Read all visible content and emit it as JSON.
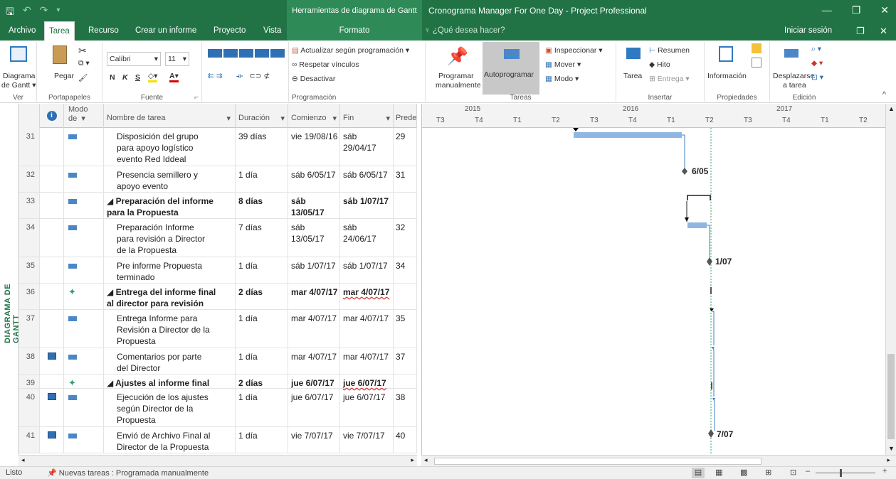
{
  "titlebar": {
    "context_title": "Herramientas de diagrama de Gantt",
    "title": "Cronograma Manager For One Day - Project Professional"
  },
  "tabs": {
    "archivo": "Archivo",
    "tarea": "Tarea",
    "recurso": "Recurso",
    "informe": "Crear un informe",
    "proyecto": "Proyecto",
    "vista": "Vista",
    "formato": "Formato",
    "tell_me": "¿Qué desea hacer?",
    "signin": "Iniciar sesión"
  },
  "ribbon": {
    "ver": {
      "label": "Ver",
      "diagrama": "Diagrama",
      "de_gantt": "de Gantt"
    },
    "portapapeles": {
      "label": "Portapapeles",
      "pegar": "Pegar"
    },
    "fuente": {
      "label": "Fuente",
      "font": "Calibri",
      "size": "11"
    },
    "programacion": {
      "label": "Programación",
      "actualizar": "Actualizar según programación",
      "respetar": "Respetar vínculos",
      "desactivar": "Desactivar"
    },
    "tareas": {
      "label": "Tareas",
      "programar": "Programar",
      "manualmente": "manualmente",
      "autoprogramar": "Autoprogramar",
      "inspeccionar": "Inspeccionar",
      "mover": "Mover",
      "modo": "Modo"
    },
    "insertar": {
      "label": "Insertar",
      "tarea": "Tarea",
      "resumen": "Resumen",
      "hito": "Hito",
      "entrega": "Entrega"
    },
    "propiedades": {
      "label": "Propiedades",
      "informacion": "Información"
    },
    "edicion": {
      "label": "Edición",
      "desplazarse": "Desplazarse",
      "a_tarea": "a tarea"
    }
  },
  "side_label": "DIAGRAMA DE GANTT",
  "table": {
    "headers": {
      "modo1": "Modo",
      "modo2": "de",
      "name": "Nombre de tarea",
      "duration": "Duración",
      "start": "Comienzo",
      "finish": "Fin",
      "pred": "Prede"
    },
    "rows": [
      {
        "id": "31",
        "name1": "Disposición del grupo",
        "name2": "para apoyo logístico",
        "name3": "evento Red Iddeal",
        "dur": "39 días",
        "start1": "vie 19/08/16",
        "start2": "",
        "fin1": "sáb",
        "fin2": "29/04/17",
        "pred": "29"
      },
      {
        "id": "32",
        "name1": "Presencia semillero y",
        "name2": "apoyo evento",
        "name3": "",
        "dur": "1 día",
        "start1": "sáb 6/05/17",
        "start2": "",
        "fin1": "sáb 6/05/17",
        "fin2": "",
        "pred": "31"
      },
      {
        "id": "33",
        "name1": "◢ Preparación del informe",
        "name2": "para la Propuesta",
        "name3": "",
        "dur": "8 días",
        "start1": "sáb",
        "start2": "13/05/17",
        "fin1": "sáb 1/07/17",
        "fin2": "",
        "pred": ""
      },
      {
        "id": "34",
        "name1": "Preparación Informe",
        "name2": "para revisión a Director",
        "name3": "de la Propuesta",
        "dur": "7 días",
        "start1": "sáb",
        "start2": "13/05/17",
        "fin1": "sáb",
        "fin2": "24/06/17",
        "pred": "32"
      },
      {
        "id": "35",
        "name1": "Pre informe Propuesta",
        "name2": "terminado",
        "name3": "",
        "dur": "1 día",
        "start1": "sáb 1/07/17",
        "start2": "",
        "fin1": "sáb 1/07/17",
        "fin2": "",
        "pred": "34"
      },
      {
        "id": "36",
        "name1": "◢ Entrega del informe final",
        "name2": "al director para revisión",
        "name3": "",
        "dur": "2 días",
        "start1": "mar 4/07/17",
        "start2": "",
        "fin1": "mar 4/07/17",
        "fin2": "",
        "pred": ""
      },
      {
        "id": "37",
        "name1": "Entrega Informe para",
        "name2": "Revisión a Director de la",
        "name3": "Propuesta",
        "dur": "1 día",
        "start1": "mar 4/07/17",
        "start2": "",
        "fin1": "mar 4/07/17",
        "fin2": "",
        "pred": "35"
      },
      {
        "id": "38",
        "name1": "Comentarios por parte",
        "name2": "del Director",
        "name3": "",
        "dur": "1 día",
        "start1": "mar 4/07/17",
        "start2": "",
        "fin1": "mar 4/07/17",
        "fin2": "",
        "pred": "37"
      },
      {
        "id": "39",
        "name1": "◢ Ajustes al informe final",
        "name2": "",
        "name3": "",
        "dur": "2 días",
        "start1": "jue 6/07/17",
        "start2": "",
        "fin1": "jue 6/07/17",
        "fin2": "",
        "pred": ""
      },
      {
        "id": "40",
        "name1": "Ejecución de los ajustes",
        "name2": "según Director de la",
        "name3": "Propuesta",
        "dur": "1 día",
        "start1": "jue 6/07/17",
        "start2": "",
        "fin1": "jue 6/07/17",
        "fin2": "",
        "pred": "38"
      },
      {
        "id": "41",
        "name1": "Envió de Archivo Final al",
        "name2": "Director de la Propuesta",
        "name3": "",
        "dur": "1 día",
        "start1": "vie 7/07/17",
        "start2": "",
        "fin1": "vie 7/07/17",
        "fin2": "",
        "pred": "40"
      }
    ]
  },
  "timescale": {
    "years": [
      "2015",
      "2016",
      "2017"
    ],
    "quarters": [
      "T3",
      "T4",
      "T1",
      "T2",
      "T3",
      "T4",
      "T1",
      "T2",
      "T3",
      "T4",
      "T1",
      "T2"
    ]
  },
  "milestones": {
    "m32": "6/05",
    "m35": "1/07",
    "m41": "7/07"
  },
  "status": {
    "ready": "Listo",
    "new_tasks": "Nuevas tareas : Programada manualmente"
  },
  "colors": {
    "accent": "#217346",
    "bar": "#8fb7e2",
    "link": "#3a7fc4"
  }
}
